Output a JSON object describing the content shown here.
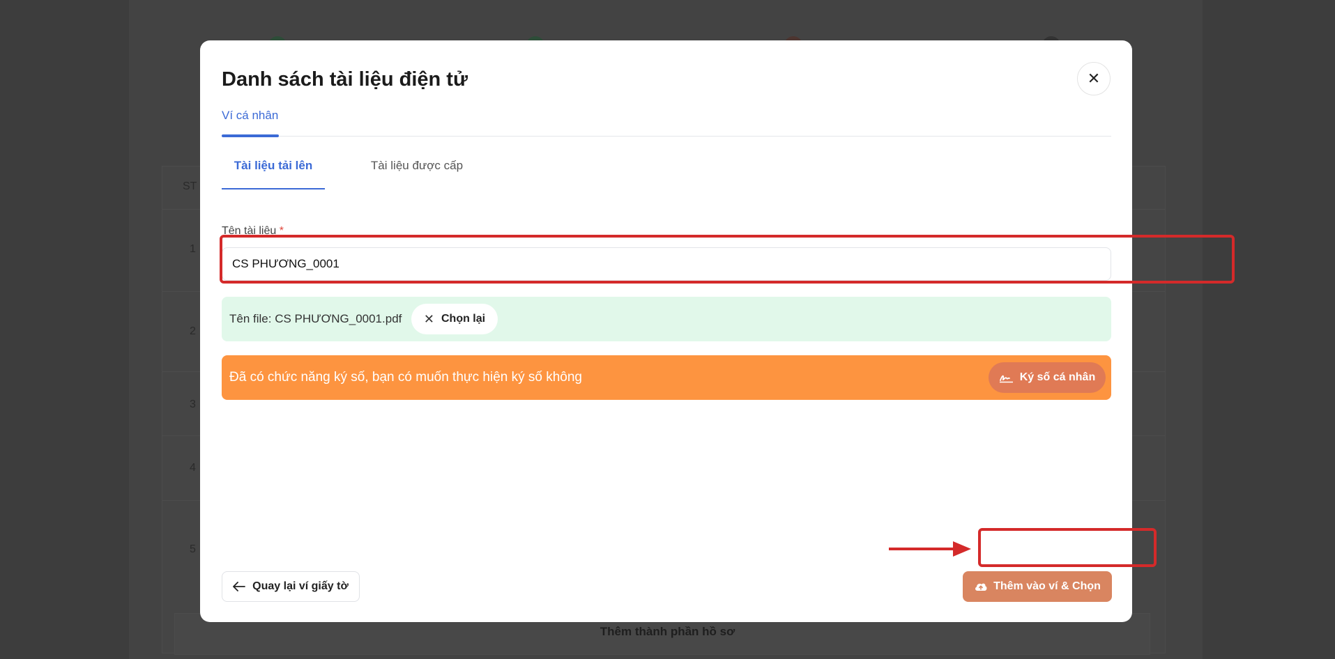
{
  "background": {
    "row_numbers": [
      "1",
      "2",
      "3",
      "4",
      "5"
    ],
    "column_header_partial": "ST",
    "footer_button_label": "Thêm thành phần hồ sơ"
  },
  "modal": {
    "title": "Danh sách tài liệu điện tử",
    "close_icon": "close-icon",
    "top_tabs": [
      {
        "label": "Ví cá nhân",
        "active": true
      }
    ],
    "sub_tabs": [
      {
        "label": "Tài liệu tải lên",
        "active": true
      },
      {
        "label": "Tài liệu được cấp",
        "active": false
      }
    ],
    "document_name": {
      "label": "Tên tài liệu",
      "required_mark": "*",
      "value": "CS PHƯƠNG_0001"
    },
    "file": {
      "name_text": "Tên file: CS PHƯƠNG_0001.pdf",
      "rechoose_label": "Chọn lại"
    },
    "sign": {
      "message": "Đã có chức năng ký số, bạn có muốn thực hiện ký số không",
      "button_label": "Ký số cá nhân",
      "icon": "signature-icon"
    },
    "footer": {
      "back_label": "Quay lại ví giấy tờ",
      "back_icon": "arrow-left-icon",
      "add_label": "Thêm vào ví & Chọn",
      "add_icon": "cloud-upload-icon"
    }
  },
  "colors": {
    "accent_blue": "#3b6ad6",
    "success_bg": "#e1f8ea",
    "warning_orange": "#fd9440",
    "add_button": "#d98560",
    "annotation_red": "#d42a2a"
  }
}
